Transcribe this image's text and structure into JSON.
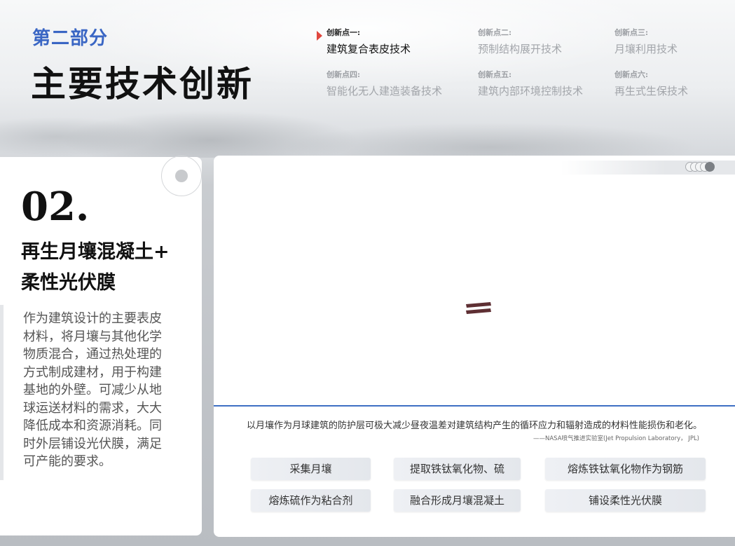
{
  "header": {
    "section_label": "第二部分",
    "title": "主要技术创新"
  },
  "innovations": [
    {
      "num": "创新点一:",
      "name": "建筑复合表皮技术",
      "active": true
    },
    {
      "num": "创新点二:",
      "name": "预制结构展开技术",
      "active": false
    },
    {
      "num": "创新点三:",
      "name": "月壤利用技术",
      "active": false
    },
    {
      "num": "创新点四:",
      "name": "智能化无人建造装备技术",
      "active": false
    },
    {
      "num": "创新点五:",
      "name": "建筑内部环境控制技术",
      "active": false
    },
    {
      "num": "创新点六:",
      "name": "再生式生保技术",
      "active": false
    }
  ],
  "left": {
    "number": "02.",
    "subtitle_line1": "再生月壤混凝土+",
    "subtitle_line2": "柔性光伏膜",
    "body": "作为建筑设计的主要表皮材料，将月壤与其他化学物质混合，通过热处理的方式制成建材，用于构建基地的外壁。可减少从地球运送材料的需求，大大降低成本和资源消耗。同时外层铺设光伏膜，满足可产能的要求。"
  },
  "right": {
    "center_icon": "equals-icon",
    "quote": "以月壤作为月球建筑的防护层可极大减少昼夜温差对建筑结构产生的循环应力和辐射造成的材料性能损伤和老化。",
    "source": "——NASA喷气推进实验室(Jet Propulsion Laboratory， JPL)"
  },
  "steps": [
    "采集月壤",
    "提取铁钛氧化物、硫",
    "熔炼铁钛氧化物作为钢筋",
    "熔炼硫作为粘合剂",
    "融合形成月壤混凝土",
    "铺设柔性光伏膜"
  ],
  "colors": {
    "accent_blue": "#3a66c4",
    "marker_red": "#e0473e",
    "divider_blue": "#3e6fc4",
    "icon_maroon": "#5e2f33"
  }
}
